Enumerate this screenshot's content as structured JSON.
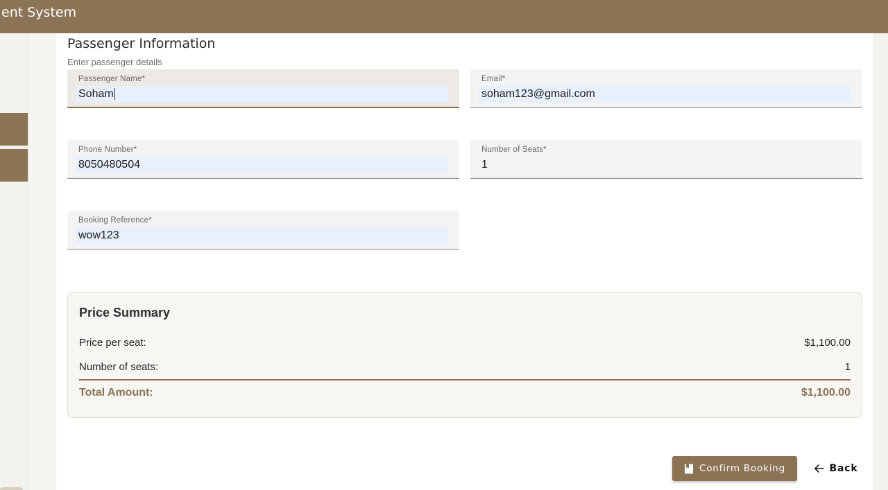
{
  "app": {
    "title": "ent System"
  },
  "section": {
    "title": "Passenger Information",
    "subtitle": "Enter passenger details"
  },
  "fields": {
    "passenger_name": {
      "label": "Passenger Name*",
      "value": "Soham"
    },
    "email": {
      "label": "Email*",
      "value": "soham123@gmail.com"
    },
    "phone": {
      "label": "Phone Number*",
      "value": "8050480504"
    },
    "seats": {
      "label": "Number of Seats*",
      "value": "1"
    },
    "booking_ref": {
      "label": "Booking Reference*",
      "value": "wow123"
    }
  },
  "summary": {
    "title": "Price Summary",
    "price_per_seat_label": "Price per seat:",
    "price_per_seat_value": "$1,100.00",
    "seats_label": "Number of seats:",
    "seats_value": "1",
    "total_label": "Total Amount:",
    "total_value": "$1,100.00"
  },
  "actions": {
    "confirm_label": "Confirm Booking",
    "back_label": "Back"
  },
  "colors": {
    "brand": "#8b7355",
    "autofill": "#e8f0fe"
  },
  "icons": {
    "confirm": "book-icon",
    "back": "arrow-left-icon"
  }
}
